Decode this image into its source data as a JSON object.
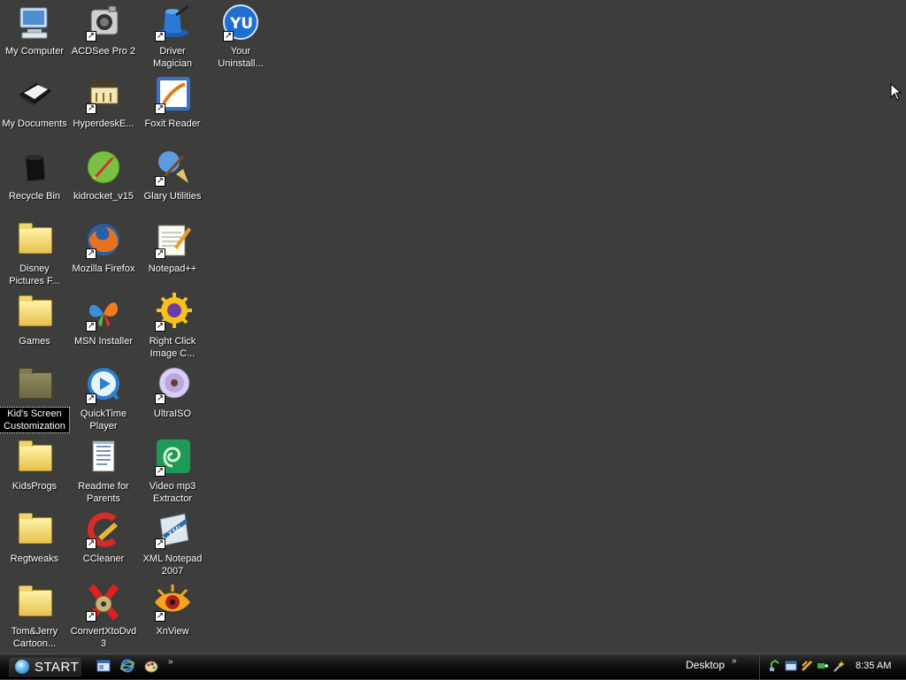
{
  "desktop": {
    "icons": [
      {
        "label": "My Computer",
        "icon": "computer-icon"
      },
      {
        "label": "ACDSee Pro 2",
        "icon": "acdsee-icon"
      },
      {
        "label": "Driver Magician",
        "icon": "magician-hat-icon"
      },
      {
        "label": "Your Uninstall...",
        "icon": "uninstaller-icon"
      },
      {
        "label": "My Documents",
        "icon": "documents-icon"
      },
      {
        "label": "HyperdeskE...",
        "icon": "hyperdesk-icon"
      },
      {
        "label": "Foxit Reader",
        "icon": "foxit-reader-icon"
      },
      {
        "label": "Recycle Bin",
        "icon": "recycle-bin-icon"
      },
      {
        "label": "kidrocket_v15",
        "icon": "rocket-icon"
      },
      {
        "label": "Glary Utilities",
        "icon": "glary-utilities-icon"
      },
      {
        "label": "Disney Pictures F...",
        "icon": "folder-icon"
      },
      {
        "label": "Mozilla Firefox",
        "icon": "firefox-icon"
      },
      {
        "label": "Notepad++",
        "icon": "notepad-icon"
      },
      {
        "label": "Games",
        "icon": "folder-icon"
      },
      {
        "label": "MSN Installer",
        "icon": "msn-butterfly-icon"
      },
      {
        "label": "Right Click Image C...",
        "icon": "gear-sun-icon"
      },
      {
        "label": "Kid's Screen Customization",
        "icon": "folder-icon"
      },
      {
        "label": "QuickTime Player",
        "icon": "quicktime-icon"
      },
      {
        "label": "UltraISO",
        "icon": "disc-icon"
      },
      {
        "label": "KidsProgs",
        "icon": "folder-icon"
      },
      {
        "label": "Readme for Parents",
        "icon": "text-document-icon"
      },
      {
        "label": "Video mp3 Extractor",
        "icon": "video-extractor-icon"
      },
      {
        "label": "Regtweaks",
        "icon": "folder-icon"
      },
      {
        "label": "CCleaner",
        "icon": "ccleaner-icon"
      },
      {
        "label": "XML Notepad 2007",
        "icon": "xml-notepad-icon"
      },
      {
        "label": "Tom&Jerry Cartoon...",
        "icon": "folder-icon"
      },
      {
        "label": "ConvertXtoDvd 3",
        "icon": "convertx-icon"
      },
      {
        "label": "XnView",
        "icon": "xnview-eye-icon"
      }
    ]
  },
  "taskbar": {
    "start_label": "START",
    "quicklaunch": [
      "explorer-icon",
      "internet-explorer-icon",
      "paint-icon"
    ],
    "more_label": "»",
    "desktop_toolbar_label": "Desktop",
    "tray_icons": [
      "network-icon",
      "window-icon",
      "tools-icon",
      "connection-icon",
      "wand-icon"
    ],
    "clock": "8:35 AM"
  },
  "colors": {
    "desktop_bg": "#3d3d3b",
    "taskbar_bg": "#000000",
    "selection_bg": "#000000"
  }
}
